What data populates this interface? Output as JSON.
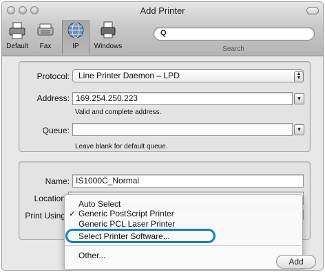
{
  "window": {
    "title": "Add Printer"
  },
  "toolbar": {
    "items": [
      {
        "label": "Default",
        "icon": "default-printer-icon"
      },
      {
        "label": "Fax",
        "icon": "fax-icon"
      },
      {
        "label": "IP",
        "icon": "globe-icon",
        "selected": true
      },
      {
        "label": "Windows",
        "icon": "windows-printer-icon"
      }
    ],
    "search": {
      "label": "Search",
      "placeholder": "",
      "icon": "magnifier-icon"
    }
  },
  "connection": {
    "protocol_label": "Protocol:",
    "protocol_value": "Line Printer Daemon – LPD",
    "address_label": "Address:",
    "address_value": "169.254.250.223",
    "address_hint": "Valid and complete address.",
    "queue_label": "Queue:",
    "queue_value": "",
    "queue_hint": "Leave blank for default queue."
  },
  "details": {
    "name_label": "Name:",
    "name_value": "IS1000C_Normal",
    "location_label": "Location",
    "print_using_label": "Print Using"
  },
  "menu": {
    "items": [
      {
        "label": "Auto Select",
        "checked": false
      },
      {
        "label": "Generic PostScript Printer",
        "checked": true
      },
      {
        "label": "Generic PCL Laser Printer",
        "checked": false
      },
      {
        "label": "Select Printer Software...",
        "checked": false,
        "circled": true
      },
      {
        "label": "Other...",
        "checked": false
      }
    ],
    "checkmark": "✓"
  },
  "add_button": {
    "label": "Add"
  },
  "colors": {
    "highlight_ring": "#0f7fc3"
  }
}
